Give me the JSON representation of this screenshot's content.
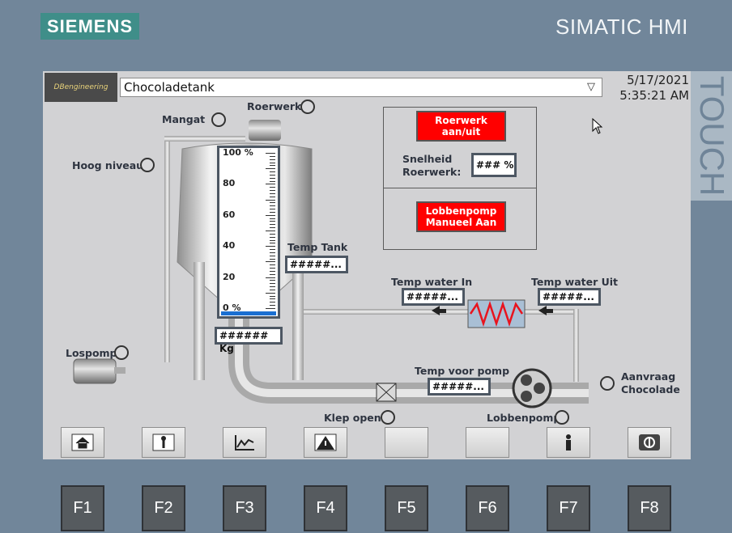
{
  "device": {
    "brand": "SIEMENS",
    "model": "SIMATIC HMI",
    "touch_label": "TOUCH"
  },
  "header": {
    "logo_text": "DBengineering",
    "screen_select_value": "Chocoladetank",
    "date": "5/17/2021",
    "time": "5:35:21 AM"
  },
  "labels": {
    "mangat": "Mangat",
    "roerwerk": "Roerwerk",
    "hoog_niveau": "Hoog niveau",
    "temp_tank": "Temp Tank",
    "temp_water_in": "Temp water In",
    "temp_water_uit": "Temp water Uit",
    "temp_voor_pomp": "Temp voor pomp",
    "lospomp": "Lospomp",
    "klep_open": "Klep open",
    "lobbenpomp": "Lobbenpomp",
    "aanvraag_line1": "Aanvraag",
    "aanvraag_line2": "Chocolade",
    "snelheid_line1": "Snelheid",
    "snelheid_line2": "Roerwerk:"
  },
  "fields": {
    "weight": "###### Kg",
    "temp_tank": "#####...",
    "temp_water_in": "#####...",
    "temp_water_uit": "#####...",
    "temp_voor_pomp": "#####...",
    "snelheid": "### %"
  },
  "buttons": {
    "roerwerk_line1": "Roerwerk",
    "roerwerk_line2": "aan/uit",
    "lobbenpomp_line1": "Lobbenpomp",
    "lobbenpomp_line2": "Manueel Aan"
  },
  "tank_scale": {
    "ticks": [
      "100 %",
      "80",
      "60",
      "40",
      "20",
      "0 %"
    ],
    "level_percent": 0
  },
  "nav_icons": [
    "home-icon",
    "wrench-icon",
    "trend-chart-icon",
    "alarm-warning-icon",
    "blank",
    "blank",
    "user-icon",
    "power-icon"
  ],
  "fkeys": [
    "F1",
    "F2",
    "F3",
    "F4",
    "F5",
    "F6",
    "F7",
    "F8"
  ],
  "colors": {
    "button_red": "#ff0000",
    "screen_bg": "#d2d2d4",
    "brand_teal": "#3f8e89",
    "level_blue": "#1a6fd1",
    "coil_red": "#e8141e"
  }
}
